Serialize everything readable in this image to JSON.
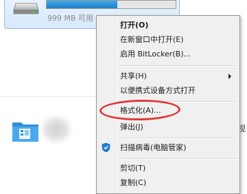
{
  "drive": {
    "free_space": "999 MB 可用",
    "used_fraction": 0.55,
    "bar_color": "#2a90d8"
  },
  "context_menu": {
    "items": [
      {
        "label": "打开(O)",
        "bold": true
      },
      {
        "label": "在新窗口中打开(E)"
      },
      {
        "label": "启用 BitLocker(B)..."
      },
      {
        "label": "共享(H)",
        "submenu": true
      },
      {
        "label": "以便携式设备方式打开"
      },
      {
        "label": "格式化(A)...",
        "highlighted": true
      },
      {
        "label": "弹出(J)"
      },
      {
        "label": "扫描病毒(电脑管家)",
        "icon": "shield-icon"
      },
      {
        "label": "剪切(T)"
      },
      {
        "label": "复制(C)"
      }
    ]
  },
  "background": {
    "edge_text": "视"
  },
  "colors": {
    "highlight_ring": "#e03a3a",
    "menu_background": "#f0f0f0",
    "folder_blue": "#2f8fd6"
  }
}
